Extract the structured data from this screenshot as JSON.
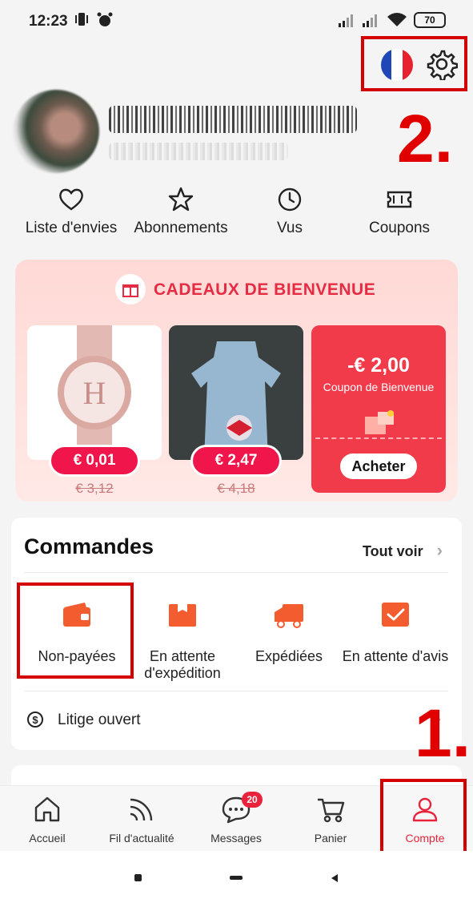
{
  "status_bar": {
    "time": "12:23",
    "battery": "70"
  },
  "annotations": {
    "step1": "1.",
    "step2": "2."
  },
  "quick_links": [
    {
      "label": "Liste d'envies",
      "icon": "heart-icon"
    },
    {
      "label": "Abonnements",
      "icon": "star-icon"
    },
    {
      "label": "Vus",
      "icon": "clock-icon"
    },
    {
      "label": "Coupons",
      "icon": "ticket-icon"
    }
  ],
  "welcome": {
    "title": "CADEAUX DE BIENVENUE",
    "products": [
      {
        "price": "€ 0,01",
        "old_price": "€ 3,12"
      },
      {
        "price": "€ 2,47",
        "old_price": "€ 4,18"
      }
    ],
    "coupon": {
      "amount": "-€ 2,00",
      "label": "Coupon de Bienvenue",
      "button": "Acheter"
    }
  },
  "orders": {
    "title": "Commandes",
    "see_all": "Tout voir",
    "items": [
      {
        "label": "Non-payées"
      },
      {
        "label": "En attente d'expédition"
      },
      {
        "label": "Expédiées"
      },
      {
        "label": "En attente d'avis"
      }
    ],
    "dispute": "Litige ouvert"
  },
  "bottom_nav": {
    "items": [
      {
        "label": "Accueil"
      },
      {
        "label": "Fil d'actualité"
      },
      {
        "label": "Messages",
        "badge": "20"
      },
      {
        "label": "Panier"
      },
      {
        "label": "Compte"
      }
    ]
  },
  "colors": {
    "accent": "#e9233b",
    "annotation": "#d40000"
  }
}
